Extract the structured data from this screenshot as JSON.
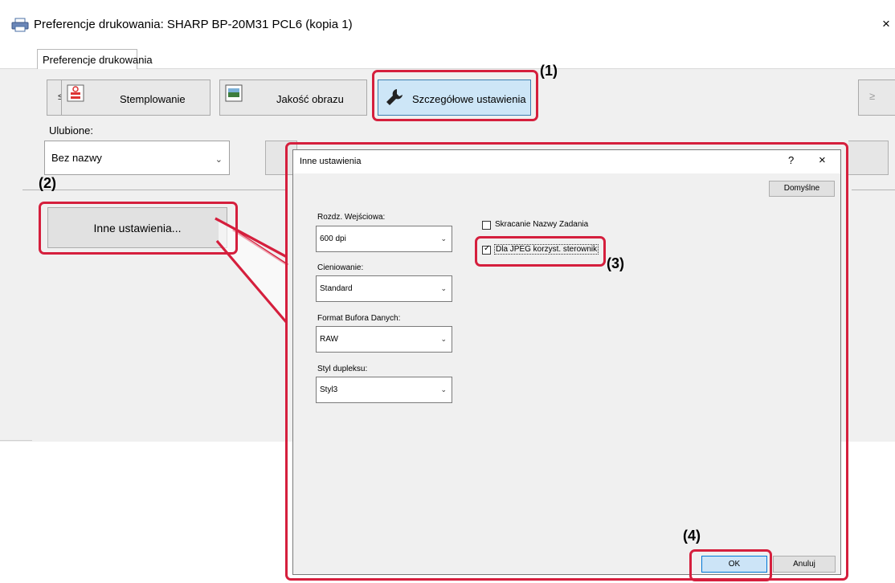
{
  "window": {
    "title": "Preferencje drukowania: SHARP BP-20M31 PCL6 (kopia 1)",
    "close_glyph": "×",
    "outer_tab_label": "Preferencje drukowania",
    "icon": "printer-icon"
  },
  "toolbar": {
    "prev_glyph": "≤",
    "next_glyph": "≥",
    "stamp_label": "Stemplowanie",
    "quality_label": "Jakość obrazu",
    "detail_label": "Szczegółowe ustawienia"
  },
  "favorites": {
    "label": "Ulubione:",
    "value": "Bez nazwy"
  },
  "other_settings_button": "Inne ustawienia...",
  "dialog": {
    "title": "Inne ustawienia",
    "help_glyph": "?",
    "close_glyph": "×",
    "default_button": "Domyślne",
    "fields": [
      {
        "label": "Rozdz. Wejściowa:",
        "value": "600 dpi"
      },
      {
        "label": "Cieniowanie:",
        "value": "Standard"
      },
      {
        "label": "Format Bufora Danych:",
        "value": "RAW"
      },
      {
        "label": "Styl dupleksu:",
        "value": "Styl3"
      }
    ],
    "checkboxes": [
      {
        "label": "Skracanie Nazwy Zadania",
        "checked": false
      },
      {
        "label": "Dla JPEG korzyst. sterownik",
        "checked": true
      }
    ],
    "ok_button": "OK",
    "cancel_button": "Anuluj"
  },
  "annotations": {
    "step1": "(1)",
    "step2": "(2)",
    "step3": "(3)",
    "step4": "(4)",
    "color": "#d51f3d"
  }
}
